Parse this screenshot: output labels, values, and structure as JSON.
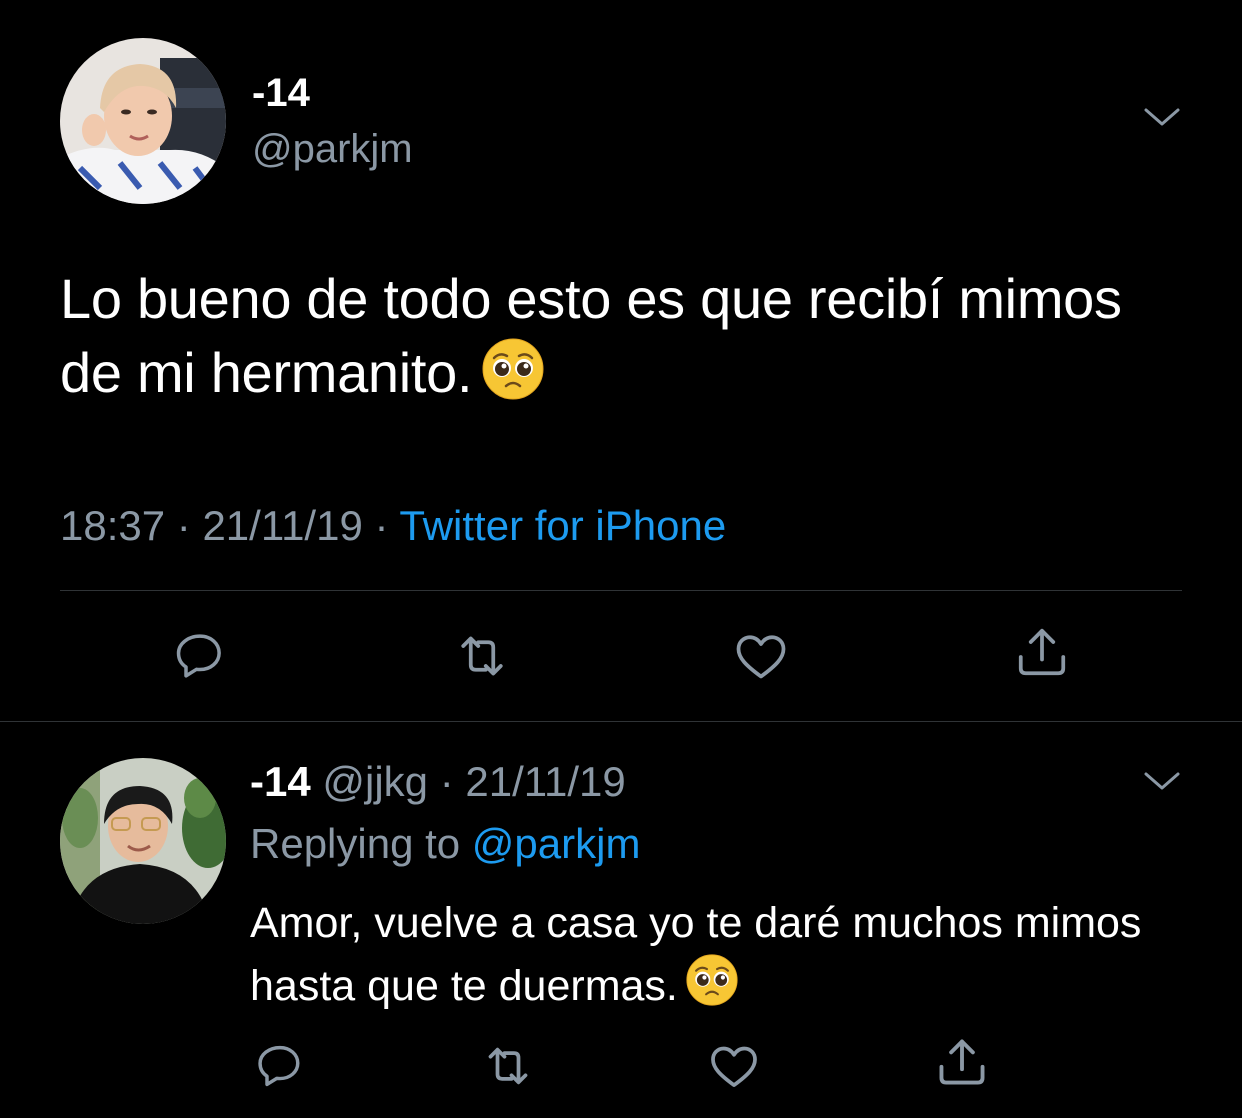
{
  "tweet": {
    "display_name": "-14",
    "handle": "@parkjm",
    "text": "Lo bueno de todo esto es que recibí mimos de mi hermanito.",
    "emoji": "pleading-face",
    "time": "18:37",
    "date": "21/11/19",
    "separator": " · ",
    "source": "Twitter for iPhone",
    "actions": {
      "reply_icon": "reply-icon",
      "retweet_icon": "retweet-icon",
      "like_icon": "heart-icon",
      "share_icon": "share-icon"
    }
  },
  "reply": {
    "display_name": "-14",
    "handle": "@jjkg",
    "separator": " · ",
    "date": "21/11/19",
    "replying_label": "Replying to",
    "replying_handle": "@parkjm",
    "text": "Amor, vuelve a casa yo te daré muchos mimos hasta que te duermas.",
    "emoji": "pleading-face"
  },
  "colors": {
    "background": "#000000",
    "text": "#ffffff",
    "muted": "#8b98a5",
    "link": "#1d9bf0",
    "divider": "#2f3336"
  }
}
